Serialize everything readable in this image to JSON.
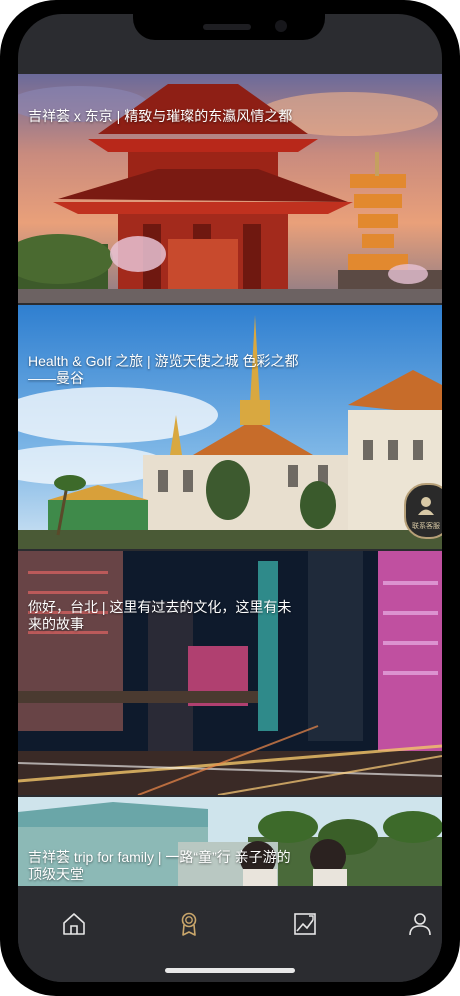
{
  "feed": {
    "cards": [
      {
        "title": "吉祥荟 x 东京 | 精致与璀璨的东瀛风情之都"
      },
      {
        "title": "Health & Golf 之旅 | 游览天使之城 色彩之都——曼谷"
      },
      {
        "title": "你好，台北 | 这里有过去的文化，这里有未来的故事"
      },
      {
        "title": "吉祥荟 trip for family | 一路“童”行 亲子游的顶级天堂"
      }
    ]
  },
  "floating_button": {
    "label": "联系客服"
  },
  "tabbar": {
    "tabs": [
      {
        "icon": "home-icon",
        "active": false
      },
      {
        "icon": "award-icon",
        "active": true
      },
      {
        "icon": "image-icon",
        "active": false
      },
      {
        "icon": "user-icon",
        "active": false
      }
    ]
  },
  "colors": {
    "active_tab": "#c9a66b",
    "inactive_tab": "#e6e6e6",
    "tabbar_bg": "#2b2c30"
  }
}
